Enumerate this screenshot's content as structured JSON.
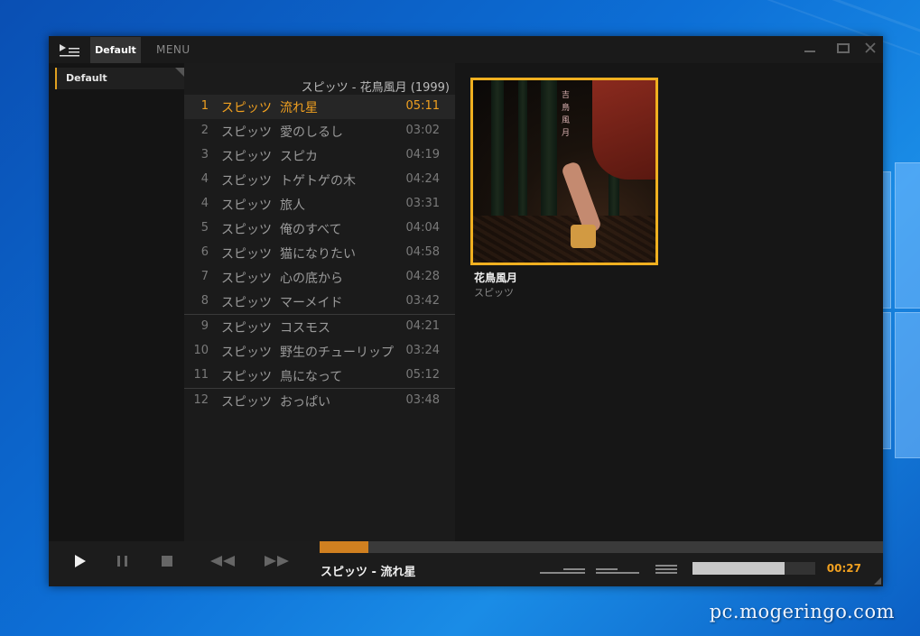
{
  "window": {
    "tab_label": "Default",
    "menu_label": "MENU",
    "minimize_icon": "minimize-icon",
    "maximize_icon": "maximize-icon",
    "close_icon": "close-icon"
  },
  "sidebar": {
    "items": [
      {
        "label": "Default"
      }
    ]
  },
  "playlist": {
    "album_header": "スピッツ - 花鳥風月 (1999)",
    "active_index": 0,
    "tracks": [
      {
        "num": "1",
        "artist": "スピッツ",
        "title": "流れ星",
        "duration": "05:11"
      },
      {
        "num": "2",
        "artist": "スピッツ",
        "title": "愛のしるし",
        "duration": "03:02"
      },
      {
        "num": "3",
        "artist": "スピッツ",
        "title": "スピカ",
        "duration": "04:19"
      },
      {
        "num": "4",
        "artist": "スピッツ",
        "title": "トゲトゲの木",
        "duration": "04:24"
      },
      {
        "num": "4",
        "artist": "スピッツ",
        "title": "旅人",
        "duration": "03:31"
      },
      {
        "num": "5",
        "artist": "スピッツ",
        "title": "俺のすべて",
        "duration": "04:04"
      },
      {
        "num": "6",
        "artist": "スピッツ",
        "title": "猫になりたい",
        "duration": "04:58"
      },
      {
        "num": "7",
        "artist": "スピッツ",
        "title": "心の底から",
        "duration": "04:28"
      },
      {
        "num": "8",
        "artist": "スピッツ",
        "title": "マーメイド",
        "duration": "03:42"
      },
      {
        "num": "9",
        "artist": "スピッツ",
        "title": "コスモス",
        "duration": "04:21"
      },
      {
        "num": "10",
        "artist": "スピッツ",
        "title": "野生のチューリップ",
        "duration": "03:24"
      },
      {
        "num": "11",
        "artist": "スピッツ",
        "title": "鳥になって",
        "duration": "05:12"
      },
      {
        "num": "12",
        "artist": "スピッツ",
        "title": "おっぱい",
        "duration": "03:48"
      }
    ]
  },
  "album": {
    "title": "花鳥風月",
    "artist": "スピッツ"
  },
  "player": {
    "now_playing": "スピッツ - 流れ星",
    "elapsed": "00:27",
    "progress_fraction": 0.087,
    "volume_fraction": 0.75,
    "play_icon": "play-icon",
    "pause_icon": "pause-icon",
    "stop_icon": "stop-icon",
    "prev_icon": "rewind-icon",
    "next_icon": "fast-forward-icon"
  },
  "colors": {
    "accent": "#f0a020",
    "progress": "#d08020",
    "window_bg": "#161616"
  },
  "watermark": "pc.mogeringo.com"
}
